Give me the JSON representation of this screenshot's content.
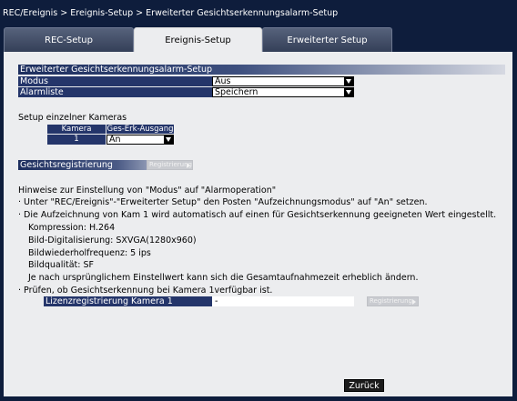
{
  "breadcrumb": "REC/Ereignis > Ereignis-Setup > Erweiterter Gesichtserkennungsalarm-Setup",
  "tabs": [
    "REC-Setup",
    "Ereignis-Setup",
    "Erweiterter Setup"
  ],
  "active_tab": "Ereignis-Setup",
  "section_title": "Erweiterter Gesichtserkennungsalarm-Setup",
  "settings": {
    "mode_label": "Modus",
    "mode_value": "Aus",
    "alarmlist_label": "Alarmliste",
    "alarmlist_value": "Speichern"
  },
  "cameras": {
    "title": "Setup einzelner Kameras",
    "col_camera": "Kamera",
    "col_output": "Ges-Erk-Ausgang",
    "row_camera": "1",
    "row_value": "An"
  },
  "face_reg": {
    "label": "Gesichtsregistrierung",
    "button": "Registrierung"
  },
  "hints": {
    "heading": "Hinweise zur Einstellung von \"Modus\" auf \"Alarmoperation\"",
    "line1": "· Unter \"REC/Ereignis\"-\"Erweiterter Setup\" den Posten \"Aufzeichnungsmodus\" auf \"An\" setzen.",
    "line2": "· Die Aufzeichnung von Kam 1 wird automatisch auf einen für Gesichtserkennung geeigneten Wert eingestellt.",
    "detail1": "Kompression: H.264",
    "detail2": "Bild-Digitalisierung: SXVGA(1280x960)",
    "detail3": "Bildwiederholfrequenz: 5 ips",
    "detail4": "Bildqualität: SF",
    "detail5": "Je nach ursprünglichem Einstellwert kann sich die Gesamtaufnahmezeit erheblich ändern.",
    "line3": "· Prüfen, ob Gesichtserkennung bei Kamera 1verfügbar ist."
  },
  "license": {
    "label": "Lizenzregistrierung Kamera 1",
    "value": "-",
    "button": "Registrierung"
  },
  "back_button": "Zurück"
}
